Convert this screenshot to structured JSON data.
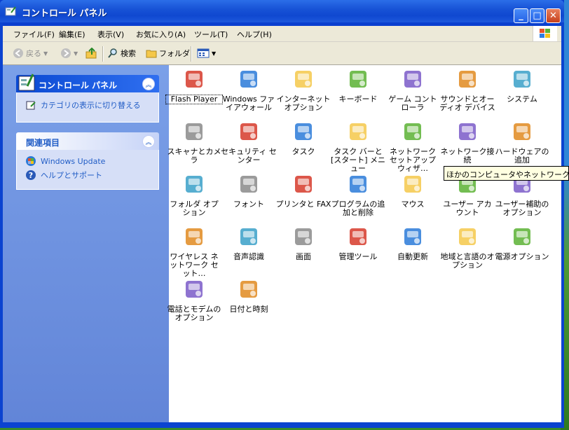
{
  "window": {
    "title": "コントロール パネル"
  },
  "menubar": [
    "ファイル(F)",
    "編集(E)",
    "表示(V)",
    "お気に入り(A)",
    "ツール(T)",
    "ヘルプ(H)"
  ],
  "toolbar": {
    "back": "戻る",
    "search": "検索",
    "folders": "フォルダ"
  },
  "panels": {
    "control": {
      "title": "コントロール パネル",
      "link": "カテゴリの表示に切り替える"
    },
    "related": {
      "title": "関連項目",
      "links": [
        "Windows Update",
        "ヘルプとサポート"
      ]
    }
  },
  "items": [
    {
      "label": "Flash Player",
      "icon": "flash-icon"
    },
    {
      "label": "Windows ファイアウォール",
      "icon": "firewall-icon"
    },
    {
      "label": "インターネット オプション",
      "icon": "internet-options-icon"
    },
    {
      "label": "キーボード",
      "icon": "keyboard-icon"
    },
    {
      "label": "ゲーム コントローラ",
      "icon": "game-controller-icon"
    },
    {
      "label": "サウンドとオーディオ デバイス",
      "icon": "speaker-icon"
    },
    {
      "label": "システム",
      "icon": "system-icon"
    },
    {
      "label": "スキャナとカメラ",
      "icon": "scanner-camera-icon"
    },
    {
      "label": "セキュリティ センター",
      "icon": "security-shield-icon"
    },
    {
      "label": "タスク",
      "icon": "scheduled-tasks-icon"
    },
    {
      "label": "タスク バーと [スタート] メニュー",
      "icon": "taskbar-icon"
    },
    {
      "label": "ネットワーク セットアップ ウィザ…",
      "icon": "network-setup-icon"
    },
    {
      "label": "ネットワーク接続",
      "icon": "network-connections-icon"
    },
    {
      "label": "ハードウェアの追加",
      "icon": "add-hardware-icon"
    },
    {
      "label": "フォルダ オプション",
      "icon": "folder-options-icon"
    },
    {
      "label": "フォント",
      "icon": "fonts-folder-icon"
    },
    {
      "label": "プリンタと FAX",
      "icon": "printer-icon"
    },
    {
      "label": "プログラムの追加と削除",
      "icon": "add-remove-programs-icon"
    },
    {
      "label": "マウス",
      "icon": "mouse-icon"
    },
    {
      "label": "ユーザー アカウント",
      "icon": "user-accounts-icon"
    },
    {
      "label": "ユーザー補助のオプション",
      "icon": "accessibility-icon"
    },
    {
      "label": "ワイヤレス ネットワーク セット…",
      "icon": "wireless-icon"
    },
    {
      "label": "音声認識",
      "icon": "speech-icon"
    },
    {
      "label": "画面",
      "icon": "display-icon"
    },
    {
      "label": "管理ツール",
      "icon": "admin-tools-icon"
    },
    {
      "label": "自動更新",
      "icon": "windows-update-icon"
    },
    {
      "label": "地域と言語のオプション",
      "icon": "globe-icon"
    },
    {
      "label": "電源オプション",
      "icon": "power-icon"
    },
    {
      "label": "電話とモデムのオプション",
      "icon": "phone-modem-icon"
    },
    {
      "label": "日付と時刻",
      "icon": "clock-icon"
    }
  ],
  "tooltip": "ほかのコンピュータやネットワーク、インターネットへ"
}
